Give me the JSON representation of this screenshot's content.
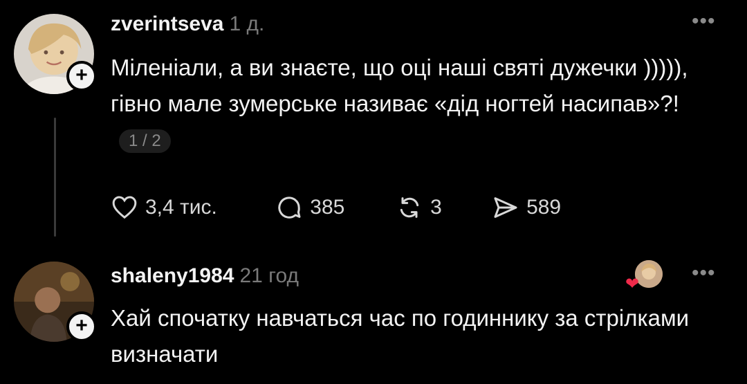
{
  "posts": [
    {
      "username": "zverintseva",
      "time": "1 д.",
      "text": "Міленіали, а ви знаєте, що оці наші святі дужечки ))))), гівно мале зумерське називає «дід ногтей насипав»?!",
      "pager": "1 / 2",
      "actions": {
        "likes": "3,4 тис.",
        "comments": "385",
        "reposts": "3",
        "shares": "589"
      },
      "more_icon": "more-horizontal-icon",
      "follow_icon": "+"
    },
    {
      "username": "shaleny1984",
      "time": "21 год",
      "text": "Хай спочатку навчаться час по годиннику за стрілками визначати",
      "more_icon": "more-horizontal-icon",
      "follow_icon": "+",
      "liked_by_author": true
    }
  ],
  "colors": {
    "background": "#000000",
    "text": "#f3f3f3",
    "muted": "#7a7a7a",
    "heart": "#f02a4a"
  }
}
